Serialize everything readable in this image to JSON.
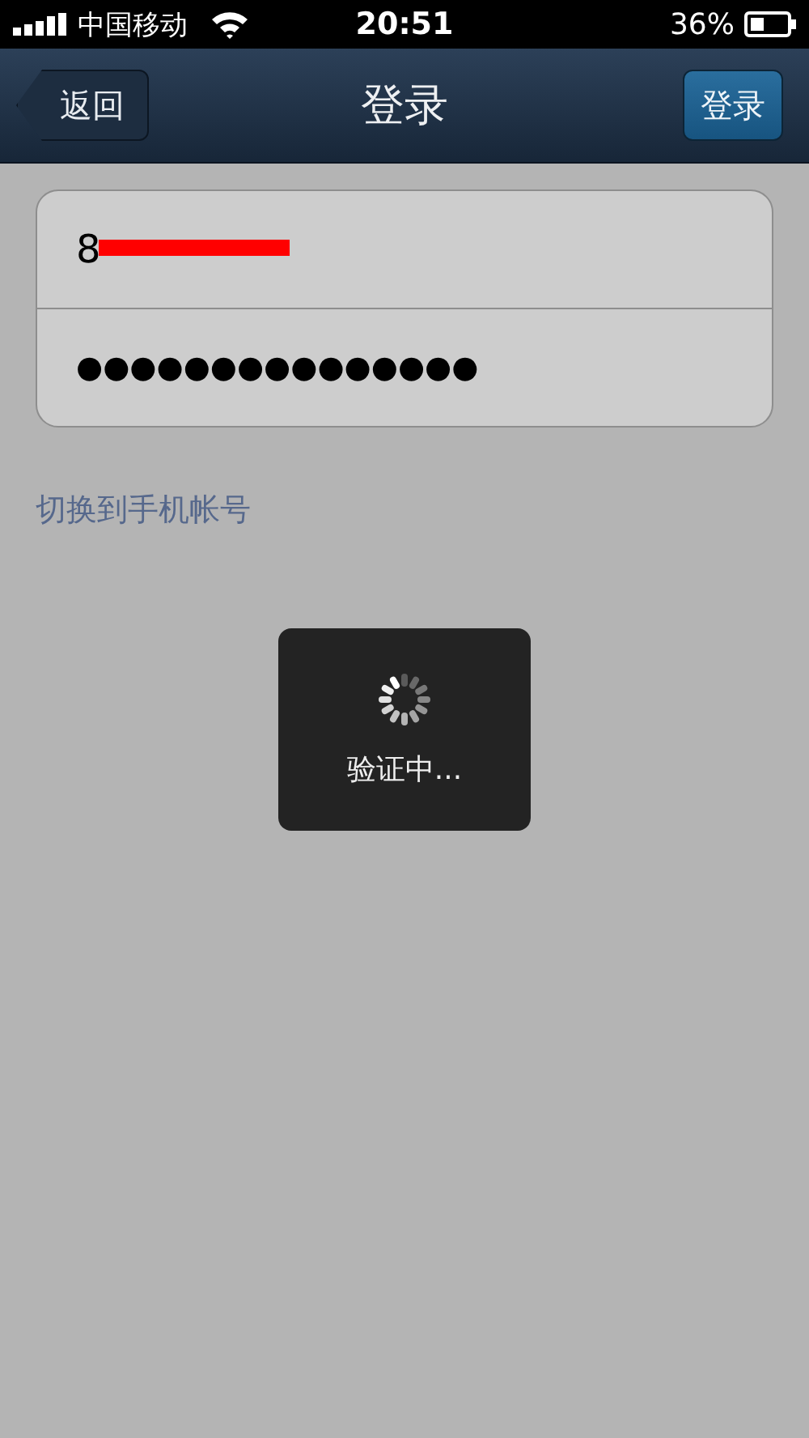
{
  "status_bar": {
    "carrier": "中国移动",
    "time": "20:51",
    "battery": "36%"
  },
  "nav_bar": {
    "back": "返回",
    "title": "登录",
    "action": "登录"
  },
  "form": {
    "account": "8",
    "password": "●●●●●●●●●●●●●●●"
  },
  "switch_link": "切换到手机帐号",
  "hud": {
    "text": "验证中..."
  }
}
